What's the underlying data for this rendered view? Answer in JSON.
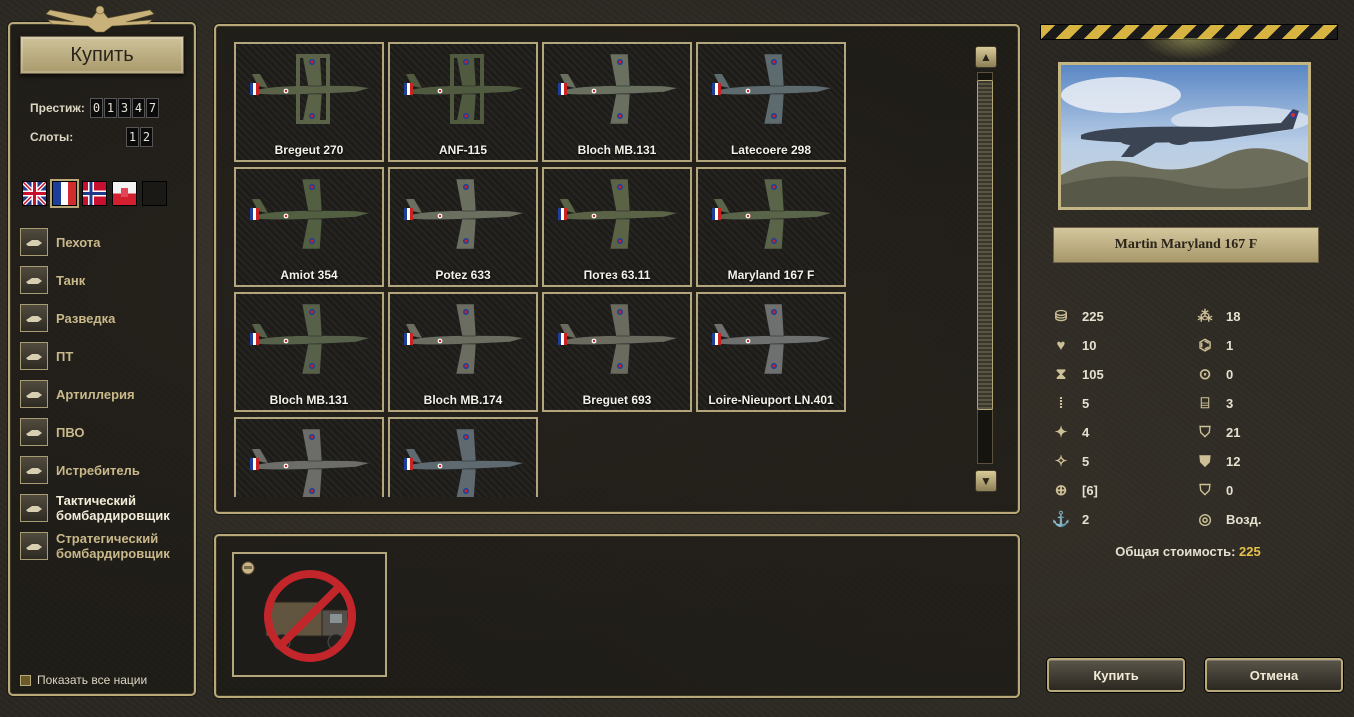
{
  "left": {
    "buy_title": "Купить",
    "prestige_label": "Престиж:",
    "prestige_digits": [
      "0",
      "1",
      "3",
      "4",
      "7"
    ],
    "slots_label": "Слоты:",
    "slots_digits": [
      "1",
      "2"
    ],
    "flags": [
      {
        "name": "flag-uk",
        "selected": false
      },
      {
        "name": "flag-france",
        "selected": true
      },
      {
        "name": "flag-norway",
        "selected": false
      },
      {
        "name": "flag-poland",
        "selected": false
      }
    ],
    "categories": [
      {
        "id": "infantry",
        "label": "Пехота",
        "icon": "infantry-icon"
      },
      {
        "id": "tank",
        "label": "Танк",
        "icon": "tank-icon"
      },
      {
        "id": "recon",
        "label": "Разведка",
        "icon": "recon-icon"
      },
      {
        "id": "at",
        "label": "ПТ",
        "icon": "anti-tank-icon"
      },
      {
        "id": "artillery",
        "label": "Артиллерия",
        "icon": "artillery-icon"
      },
      {
        "id": "aa",
        "label": "ПВО",
        "icon": "anti-air-icon"
      },
      {
        "id": "fighter",
        "label": "Истребитель",
        "icon": "fighter-icon"
      },
      {
        "id": "tactical",
        "label": "Тактический бомбардировщик",
        "icon": "tactical-bomber-icon",
        "active": true
      },
      {
        "id": "strategic",
        "label": "Стратегический бомбардировщик",
        "icon": "strategic-bomber-icon"
      }
    ],
    "show_all_label": "Показать все нации"
  },
  "units": [
    {
      "name": "Bregeut 270",
      "icon": "biplane-icon"
    },
    {
      "name": "ANF-115",
      "icon": "biplane-icon"
    },
    {
      "name": "Bloch MB.131",
      "icon": "bomber-icon"
    },
    {
      "name": "Latecoere 298",
      "icon": "seaplane-icon"
    },
    {
      "name": "Amiot 354",
      "icon": "bomber-icon"
    },
    {
      "name": "Potez 633",
      "icon": "bomber-icon"
    },
    {
      "name": "Потез 63.11",
      "icon": "bomber-icon"
    },
    {
      "name": "Maryland 167 F",
      "icon": "bomber-icon"
    },
    {
      "name": "Bloch MB.131",
      "icon": "bomber-icon"
    },
    {
      "name": "Bloch MB.174",
      "icon": "bomber-icon"
    },
    {
      "name": "Breguet 693",
      "icon": "bomber-icon"
    },
    {
      "name": "Loire-Nieuport LN.401",
      "icon": "dive-bomber-icon"
    },
    {
      "name": "",
      "icon": "bomber-icon"
    },
    {
      "name": "",
      "icon": "bomber-icon"
    }
  ],
  "detail": {
    "unit_name": "Martin Maryland 167 F",
    "stats_left": [
      {
        "icon": "cost-icon",
        "value": "225"
      },
      {
        "icon": "strength-icon",
        "value": "10"
      },
      {
        "icon": "fuel-icon",
        "value": "105"
      },
      {
        "icon": "ammo-icon",
        "value": "5"
      },
      {
        "icon": "soft-attack-icon",
        "value": "4"
      },
      {
        "icon": "hard-attack-icon",
        "value": "5"
      },
      {
        "icon": "air-attack-icon",
        "value": "[6]"
      },
      {
        "icon": "naval-attack-icon",
        "value": "2"
      }
    ],
    "stats_right": [
      {
        "icon": "movement-icon",
        "value": "18"
      },
      {
        "icon": "spotting-icon",
        "value": "1"
      },
      {
        "icon": "range-icon",
        "value": "0"
      },
      {
        "icon": "initiative-icon",
        "value": "3"
      },
      {
        "icon": "ground-defense-icon",
        "value": "21"
      },
      {
        "icon": "air-defense-icon",
        "value": "12"
      },
      {
        "icon": "close-defense-icon",
        "value": "0"
      },
      {
        "icon": "target-type-icon",
        "value": "Возд."
      }
    ],
    "total_label": "Общая стоимость:",
    "total_value": "225"
  },
  "buttons": {
    "buy": "Купить",
    "cancel": "Отмена"
  },
  "colors": {
    "accent": "#b9a978",
    "gold_value": "#e7c24a"
  }
}
